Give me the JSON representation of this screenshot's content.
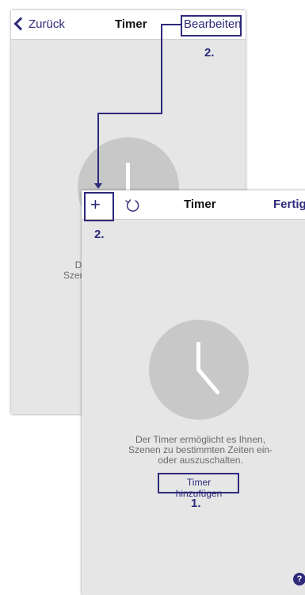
{
  "back_screen": {
    "nav": {
      "back_label": "Zurück",
      "title": "Timer",
      "edit_label": "Bearbeiten"
    },
    "description_partial_1": "Der",
    "description_partial_2": "Szene"
  },
  "front_screen": {
    "nav": {
      "add_symbol": "+",
      "title": "Timer",
      "done_label": "Fertig"
    },
    "description": [
      "Der Timer ermöglicht es Ihnen,",
      "Szenen zu bestimmten Zeiten ein-",
      "oder auszuschalten."
    ],
    "add_timer_label": "Timer hinzufügen",
    "help_symbol": "?"
  },
  "annotations": {
    "step_edit": "2.",
    "step_add": "2.",
    "step_add_timer": "1."
  },
  "colors": {
    "accent": "#2e2a7a",
    "background": "#e6e6e6",
    "clock": "#c8c8c8"
  }
}
